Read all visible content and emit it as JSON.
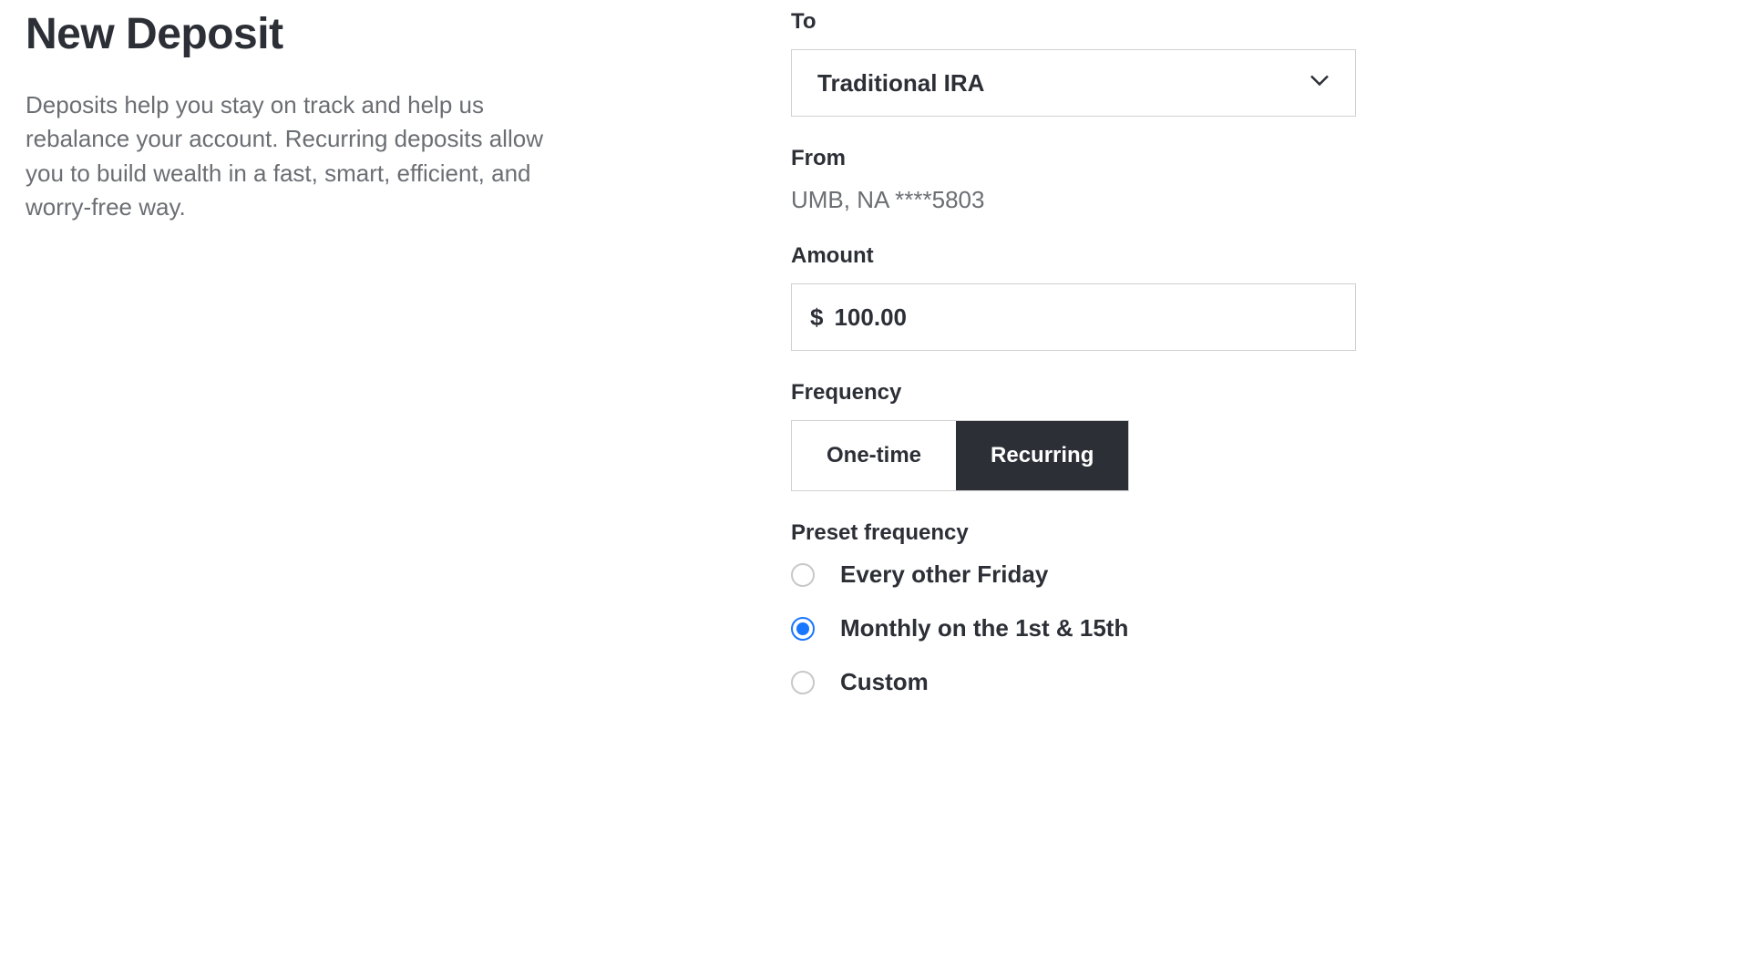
{
  "header": {
    "title": "New Deposit",
    "description": "Deposits help you stay on track and help us rebalance your account. Recurring deposits allow you to build wealth in a fast, smart, efficient, and worry-free way."
  },
  "form": {
    "to": {
      "label": "To",
      "value": "Traditional IRA"
    },
    "from": {
      "label": "From",
      "value": "UMB, NA ****5803"
    },
    "amount": {
      "label": "Amount",
      "currency": "$",
      "value": "100.00"
    },
    "frequency": {
      "label": "Frequency",
      "options": {
        "onetime": "One-time",
        "recurring": "Recurring"
      }
    },
    "preset": {
      "label": "Preset frequency",
      "options": [
        "Every other Friday",
        "Monthly on the 1st & 15th",
        "Custom"
      ]
    }
  }
}
